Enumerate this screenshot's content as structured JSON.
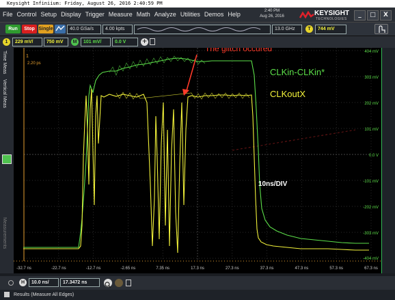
{
  "caption": "Keysight Infiniium: Friday, August 26, 2016 2:40:59 PM",
  "menu": [
    "File",
    "Control",
    "Setup",
    "Display",
    "Trigger",
    "Measure",
    "Math",
    "Analyze",
    "Utilities",
    "Demos",
    "Help"
  ],
  "clock": {
    "time": "2:40 PM",
    "date": "Aug 26, 2016"
  },
  "brand": {
    "name": "KEYSIGHT",
    "sub": "TECHNOLOGIES"
  },
  "window_buttons": [
    "_",
    "□",
    "X"
  ],
  "acquisition": {
    "run": "Run",
    "stop": "Stop",
    "single": "Single",
    "sample_rate": "40.0 GSa/s",
    "points": "4.00 kpts",
    "bandwidth": "13.0 GHz",
    "trigger_level": "744 mV",
    "trigger_badge": "T"
  },
  "channels": {
    "ch1_scale": "229 mV/",
    "ch1_offset": "750 mV",
    "m_scale": "101 mV/",
    "m_offset": "0.0 V",
    "ch1_label": "1",
    "m_label": "M"
  },
  "tabs": [
    "Time Meas",
    "Vertical Meas",
    "Measurements"
  ],
  "scale_labels": [
    "404 mV",
    "303 mV",
    "202 mV",
    "101 mV",
    "0.0 V",
    "-101 mV",
    "-202 mV",
    "-303 mV",
    "-404 mV"
  ],
  "time_labels": [
    "-32.7 ns",
    "-22.7 ns",
    "-12.7 ns",
    "-2.65 ns",
    "7.35 ns",
    "17.3 ns",
    "27.3 ns",
    "37.3 ns",
    "47.3 ns",
    "57.3 ns",
    "67.3 ns"
  ],
  "annotations": {
    "glitch": "The glitch occured",
    "clkin": "CLKin-CLKin*",
    "clkout": "CLKoutX",
    "div": "10ns/DIV",
    "ps": "2.20 ps",
    "marker": "1"
  },
  "horizontal": {
    "badge": "H",
    "scale": "10.0 ns/",
    "position": "17.3472 ns"
  },
  "status": "Results  (Measure All Edges)",
  "colors": {
    "green": "#5de04a",
    "yellow": "#f2f23a",
    "red": "#ff3b2a",
    "orange": "#e8a030"
  }
}
